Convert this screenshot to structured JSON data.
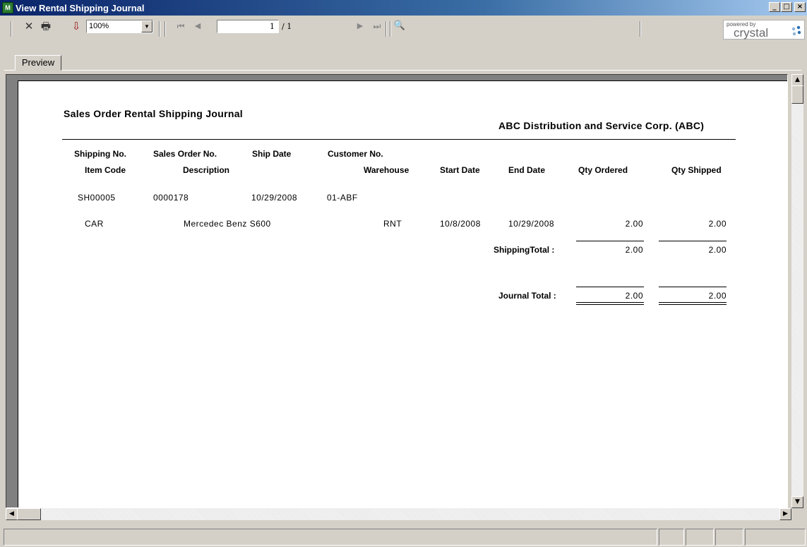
{
  "window": {
    "title": "View Rental Shipping Journal",
    "app_icon": "M",
    "minimize_glyph": "_",
    "maximize_glyph": "□",
    "close_glyph": "×"
  },
  "toolbar": {
    "icons": [
      "close-icon",
      "print-icon",
      "export-icon",
      "first-page-icon",
      "previous-page-icon",
      "next-page-icon",
      "last-page-icon",
      "search-icon"
    ],
    "close_glyph": "✕",
    "print_glyph": "🖶",
    "export_glyph": "⇩",
    "first_glyph": "⏮",
    "prev_glyph": "◀",
    "next_glyph": "▶",
    "last_glyph": "⏭",
    "search_glyph": "🔍",
    "zoom_value": "100%",
    "current_page": "1",
    "total_pages": "/ 1",
    "logo_powered": "powered by",
    "logo_word": "crystal"
  },
  "tabs": [
    {
      "label": "Preview"
    }
  ],
  "report": {
    "title": "Sales Order Rental Shipping Journal",
    "company": "ABC Distribution and Service Corp. (ABC)",
    "headers": {
      "shipping_no": "Shipping No.",
      "sales_order_no": "Sales Order No.",
      "ship_date": "Ship Date",
      "customer_no": "Customer No.",
      "item_code": "Item Code",
      "description": "Description",
      "warehouse": "Warehouse",
      "start_date": "Start Date",
      "end_date": "End Date",
      "qty_ordered": "Qty Ordered",
      "qty_shipped": "Qty Shipped"
    },
    "order": {
      "shipping_no": "SH00005",
      "sales_order_no": "0000178",
      "ship_date": "10/29/2008",
      "customer_no": "01-ABF"
    },
    "line": {
      "item_code": "CAR",
      "description": "Mercedec Benz S600",
      "warehouse": "RNT",
      "start_date": "10/8/2008",
      "end_date": "10/29/2008",
      "qty_ordered": "2.00",
      "qty_shipped": "2.00"
    },
    "shipping_total": {
      "label": "ShippingTotal :",
      "qty_ordered": "2.00",
      "qty_shipped": "2.00"
    },
    "journal_total": {
      "label": "Journal Total :",
      "qty_ordered": "2.00",
      "qty_shipped": "2.00"
    }
  }
}
